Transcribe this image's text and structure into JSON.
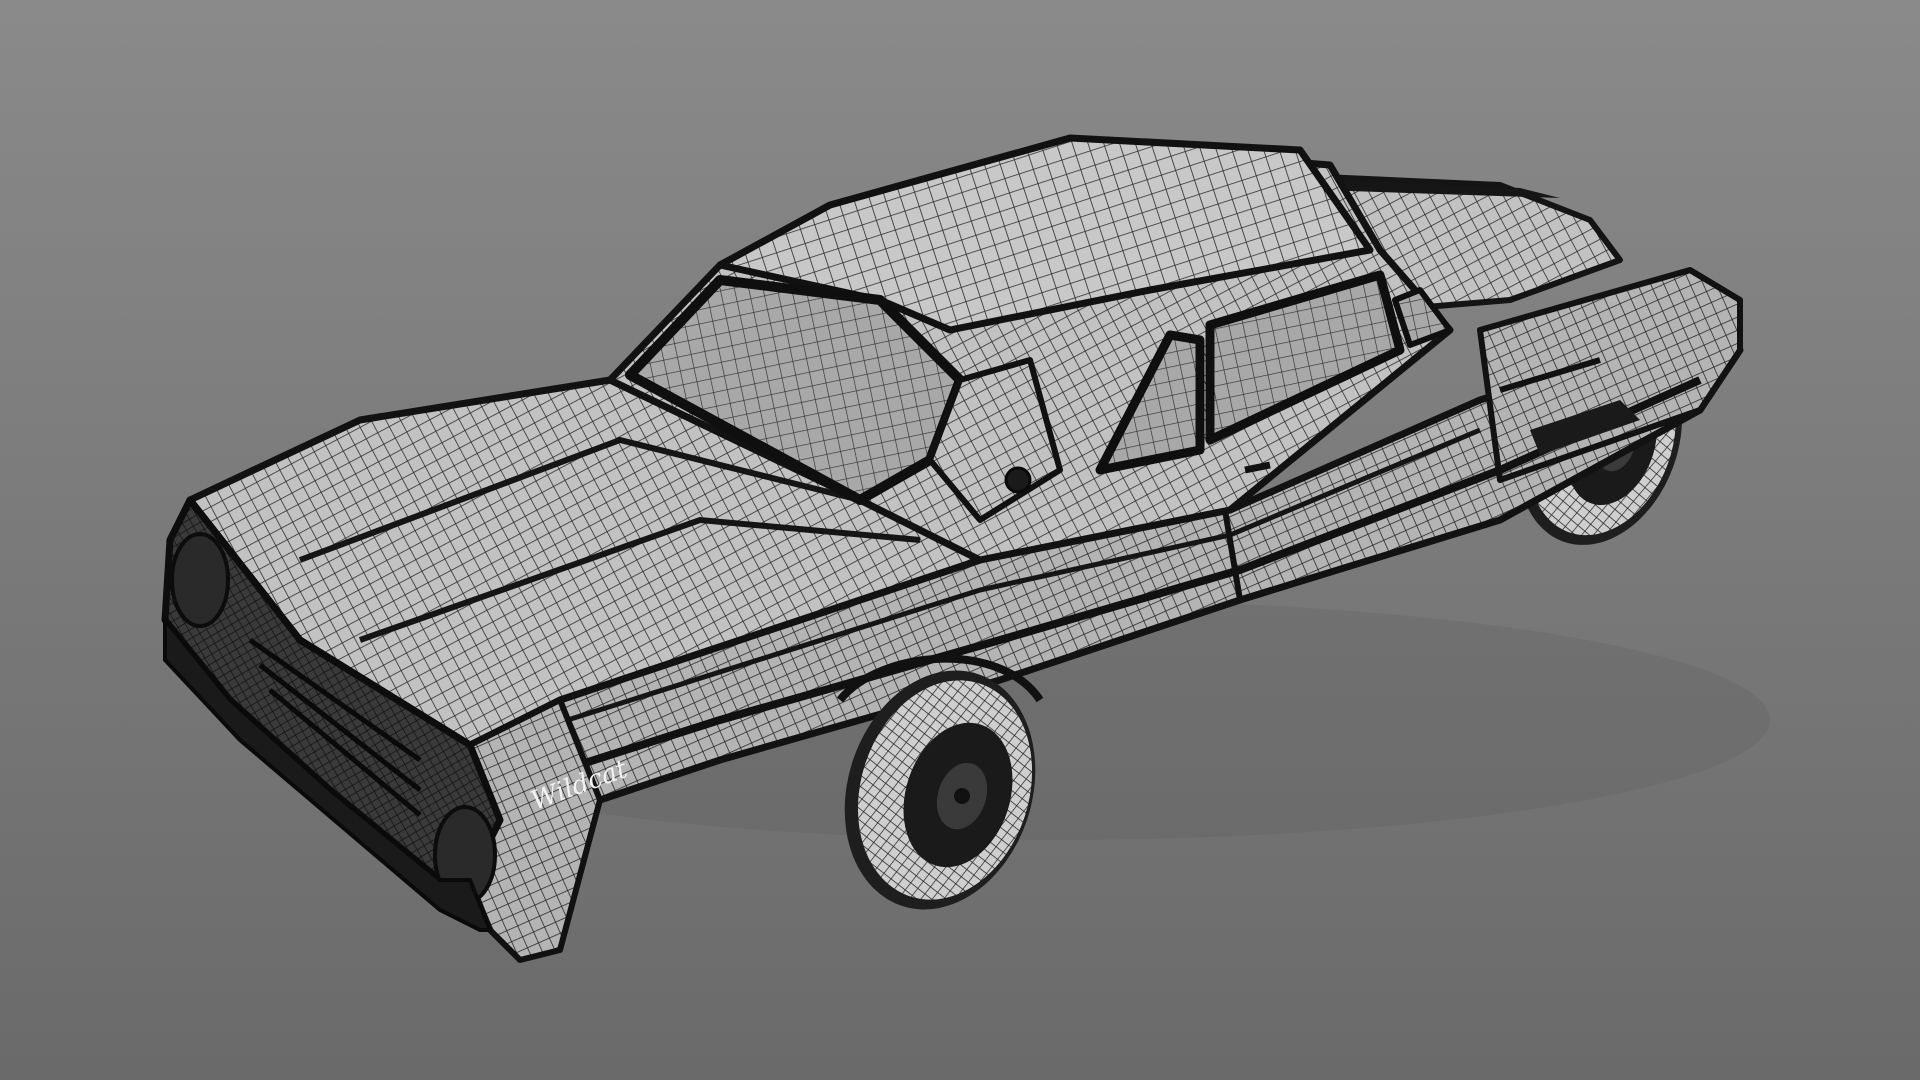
{
  "scene": {
    "subject": "wireframe-classic-sedan",
    "background_top": "#8a8a8a",
    "background_bottom": "#6a6a6a",
    "body_color": "#1a1a1a",
    "panel_color": "#bdbdbd",
    "glass_color": "#9e9e9e",
    "wire_color": "#1c1c1c",
    "tire_color": "#202020",
    "highlight_color": "#e0e0e0"
  },
  "emblem": {
    "script": "Wildcat"
  }
}
